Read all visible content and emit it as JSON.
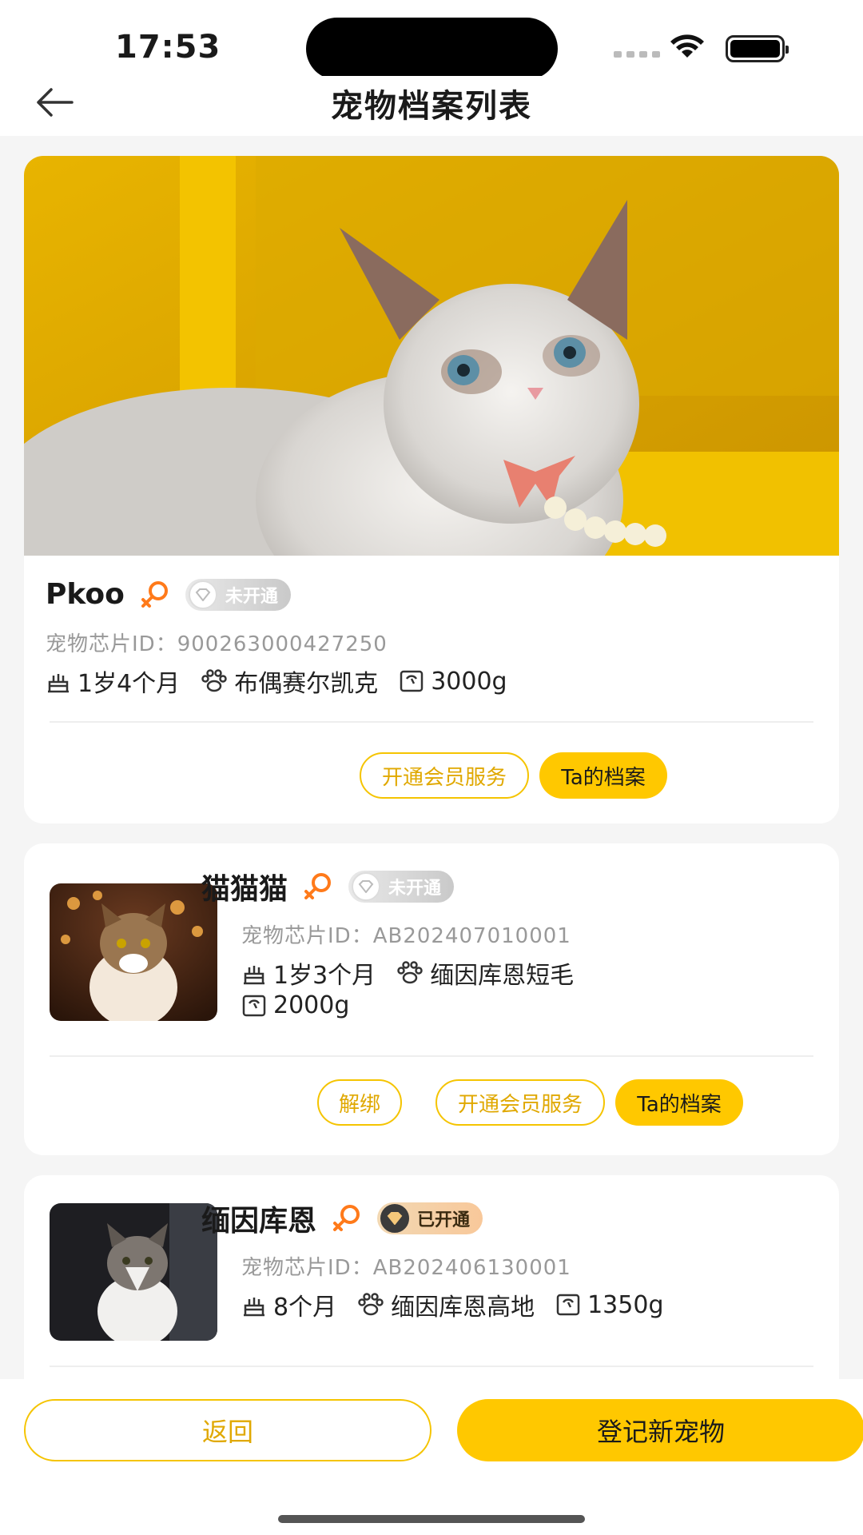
{
  "status": {
    "time": "17:53"
  },
  "nav": {
    "title": "宠物档案列表"
  },
  "colors": {
    "accent": "#ffc800",
    "accent_text": "#e0a800",
    "gender_female": "#ff7a1a"
  },
  "pets": [
    {
      "name": "Pkoo",
      "vip_status": "未开通",
      "chip_label": "宠物芯片ID：",
      "chip_id": "900263000427250",
      "age": "1岁4个月",
      "breed": "布偶赛尔凯克",
      "weight": "3000g",
      "buttons": {
        "membership": "开通会员服务",
        "profile": "Ta的档案"
      }
    },
    {
      "name": "猫猫猫",
      "vip_status": "未开通",
      "chip_label": "宠物芯片ID：",
      "chip_id": "AB202407010001",
      "age": "1岁3个月",
      "breed": "缅因库恩短毛",
      "weight": "2000g",
      "buttons": {
        "unbind": "解绑",
        "membership": "开通会员服务",
        "profile": "Ta的档案"
      }
    },
    {
      "name": "缅因库恩",
      "vip_status": "已开通",
      "chip_label": "宠物芯片ID：",
      "chip_id": "AB202406130001",
      "age": "8个月",
      "breed": "缅因库恩高地",
      "weight": "1350g"
    }
  ],
  "bottom": {
    "back_label": "返回",
    "register_label": "登记新宠物"
  }
}
